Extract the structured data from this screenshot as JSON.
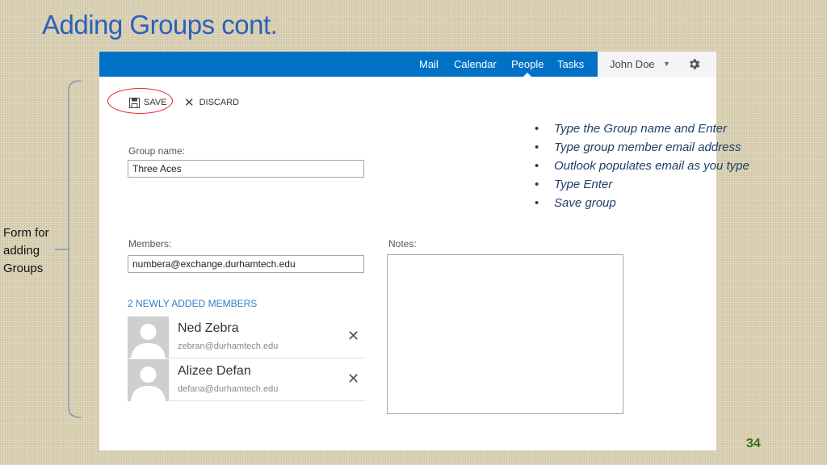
{
  "slide": {
    "title": "Adding Groups cont.",
    "side_label_lines": [
      "Form for",
      "adding",
      "Groups"
    ],
    "page_number": "34",
    "bullets": [
      "Type the Group name and Enter",
      "Type group member email address",
      "Outlook populates email as you type",
      "Type Enter",
      "Save group"
    ]
  },
  "app": {
    "nav": [
      "Mail",
      "Calendar",
      "People",
      "Tasks"
    ],
    "active_nav": "People",
    "user": "John Doe",
    "icons": {
      "save": "save-icon",
      "discard": "close-icon",
      "settings": "gear-icon"
    },
    "toolbar": {
      "save_label": "SAVE",
      "discard_label": "DISCARD"
    },
    "form": {
      "group_name_label": "Group name:",
      "group_name_value": "Three Aces",
      "members_label": "Members:",
      "members_value": "numbera@exchange.durhamtech.edu",
      "notes_label": "Notes:",
      "added_heading": "2 NEWLY ADDED MEMBERS",
      "members": [
        {
          "name": "Ned Zebra",
          "email": "zebran@durhamtech.edu"
        },
        {
          "name": "Alizee Defan",
          "email": "defana@durhamtech.edu"
        }
      ]
    }
  },
  "colors": {
    "topbar": "#0072c6",
    "title": "#2a62b8",
    "highlight_ring": "#e0202a",
    "link": "#2f7dc6",
    "page_number": "#3a6e16"
  }
}
